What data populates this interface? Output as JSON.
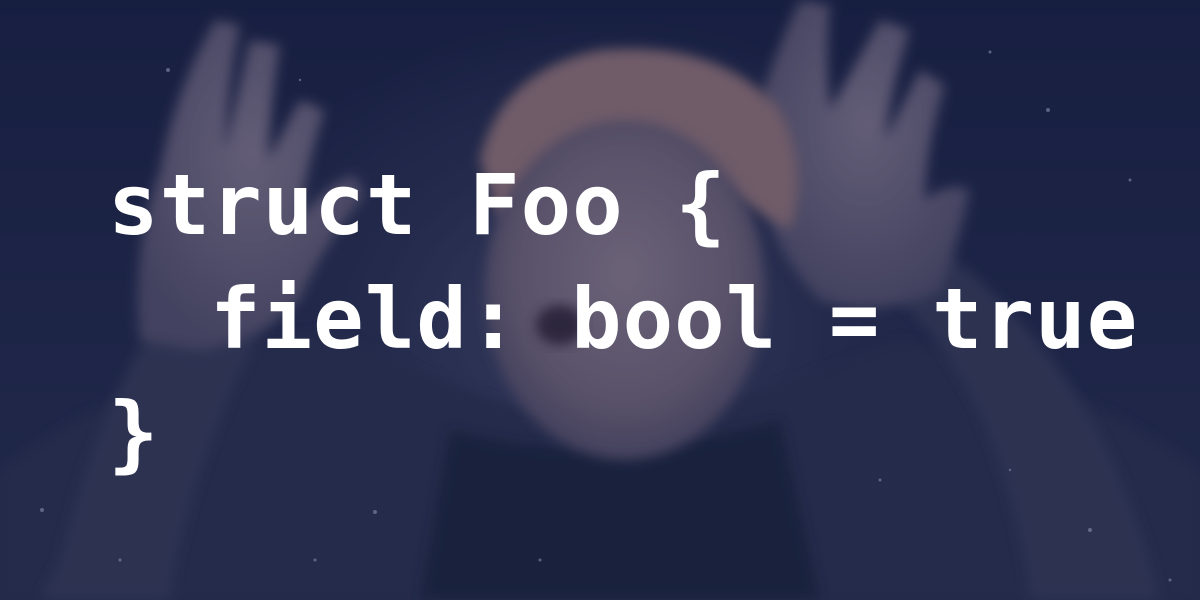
{
  "code": {
    "line1": "struct Foo {",
    "line2": "field: bool = true",
    "line3": "}"
  },
  "background": {
    "image": "blurred-photo-person-hands-on-head",
    "base_color": "#1c2342",
    "text_color": "#ffffff"
  }
}
